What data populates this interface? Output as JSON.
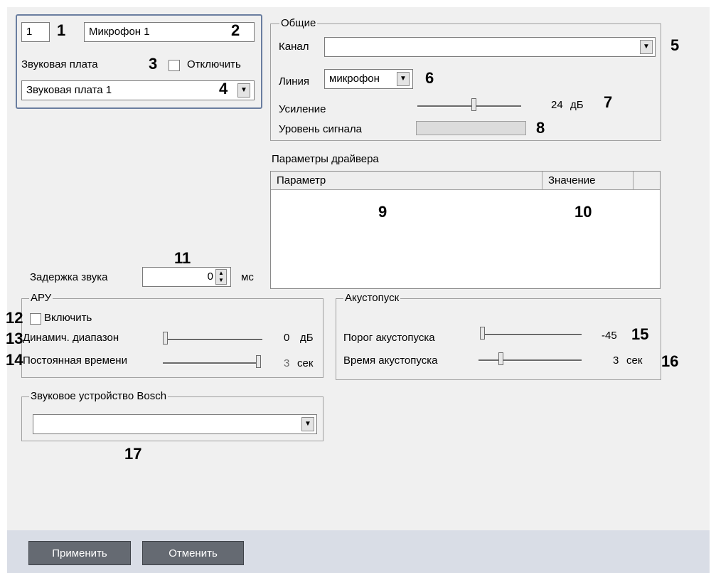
{
  "topleft": {
    "id_value": "1",
    "name_value": "Микрофон 1",
    "soundcard_label": "Звуковая плата",
    "disable_label": "Отключить",
    "soundcard_value": "Звуковая плата 1"
  },
  "general": {
    "title": "Общие",
    "channel_label": "Канал",
    "channel_value": "",
    "line_label": "Линия",
    "line_value": "микрофон",
    "gain_label": "Усиление",
    "gain_value": "24",
    "gain_unit": "дБ",
    "signal_label": "Уровень сигнала",
    "gain_level": 0.55
  },
  "driver": {
    "title": "Параметры драйвера",
    "columns": [
      "Параметр",
      "Значение"
    ]
  },
  "delay": {
    "label": "Задержка звука",
    "value": "0",
    "unit": "мс"
  },
  "aru": {
    "title": "АРУ",
    "enable_label": "Включить",
    "dyn_label": "Динамич. диапазон",
    "dyn_value": "0",
    "dyn_unit": "дБ",
    "time_label": "Постоянная времени",
    "time_value": "3",
    "time_unit": "сек",
    "dyn_level": 0.0,
    "time_level": 1.0
  },
  "acoustic": {
    "title": "Акустопуск",
    "threshold_label": "Порог акустопуска",
    "threshold_value": "-45",
    "time_label": "Время акустопуска",
    "time_value": "3",
    "time_unit": "сек",
    "threshold_level": 0.0,
    "time_level": 0.2
  },
  "bosch": {
    "title": "Звуковое устройство Bosch",
    "value": ""
  },
  "markers": [
    "1",
    "2",
    "3",
    "4",
    "5",
    "6",
    "7",
    "8",
    "9",
    "10",
    "11",
    "12",
    "13",
    "14",
    "15",
    "16",
    "17"
  ],
  "buttons": {
    "apply": "Применить",
    "cancel": "Отменить"
  },
  "icons": {
    "dropdown": "chevron-down-icon",
    "spin": "spin-arrows-icon"
  }
}
